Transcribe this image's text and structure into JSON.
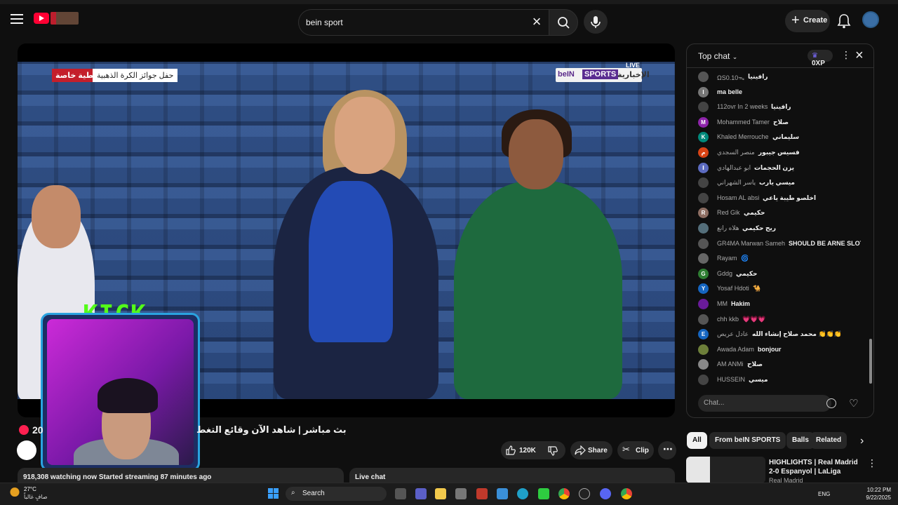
{
  "topbar": {
    "search_value": "bein sport",
    "create_label": "Create"
  },
  "video": {
    "badge_red": "تغطية خاصة",
    "badge_white": "حفل جوائز الكرة الذهبية",
    "bein_logo": "beIN",
    "bein_sports": "SPORTS",
    "bein_ar": "الإخبارية",
    "live_tag": "LIVE",
    "overlay_kick": "KICK"
  },
  "info": {
    "viewers_short": "20",
    "title": "بث مباشر | شاهد الآن وقائع التغط",
    "likes": "120K",
    "share_label": "Share",
    "clip_label": "Clip",
    "desc_text": "918,308 watching now  Started streaming 87 minutes ago",
    "live_chat_label": "Live chat"
  },
  "chat": {
    "header_title": "Top chat",
    "xp_label": "0XP",
    "input_placeholder": "Chat...",
    "messages": [
      {
        "author": "ΩS0.10ᯓ",
        "text": "رافينيا",
        "color": "#555",
        "initial": ""
      },
      {
        "author": "",
        "text": "ma belle",
        "color": "#777",
        "initial": "I"
      },
      {
        "author": "112ovr In 2 weeks",
        "text": "رافينيا",
        "color": "#444",
        "initial": ""
      },
      {
        "author": "Mohammed Tamer",
        "text": "صلاح",
        "color": "#8e24aa",
        "initial": "M"
      },
      {
        "author": "Khaled Merrouche",
        "text": "سليماني",
        "color": "#00897b",
        "initial": "K"
      },
      {
        "author": "منصر السجدي",
        "text": "فسيس جيبور",
        "color": "#d84315",
        "initial": "م"
      },
      {
        "author": "ابو عبدالهادي",
        "text": "يزن الحجمات",
        "color": "#5c6bc0",
        "initial": "ا"
      },
      {
        "author": "ياسر الشهراني",
        "text": "ميسي يارب",
        "color": "#444",
        "initial": ""
      },
      {
        "author": "Hosam AL absi",
        "text": "اخلصو طيبة ياعي",
        "color": "#444",
        "initial": ""
      },
      {
        "author": "Red Gik",
        "text": "حكيمي",
        "color": "#8d6e63",
        "initial": "R"
      },
      {
        "author": "هلاه رانع",
        "text": "ريح حكيمي",
        "color": "#546e7a",
        "initial": ""
      },
      {
        "author": "GR4MA Marwan Sameh",
        "text": "SHOULD BE ARNE SLOT",
        "color": "#555",
        "initial": ""
      },
      {
        "author": "Rayam",
        "text": "🌀",
        "color": "#666",
        "initial": ""
      },
      {
        "author": "Gddg",
        "text": "حكيمي",
        "color": "#2e7d32",
        "initial": "G"
      },
      {
        "author": "Yosaf Hdoti",
        "text": "🐪",
        "color": "#1565c0",
        "initial": "Y"
      },
      {
        "author": "MM",
        "text": "Hakim",
        "color": "#6a1b9a",
        "initial": ""
      },
      {
        "author": "chh kkb",
        "text": "💗💗💗",
        "color": "#555",
        "initial": ""
      },
      {
        "author": "عادل عريص",
        "text": "محمد صلاح إنشاء الله 👏👏👏",
        "color": "#1565c0",
        "initial": "E"
      },
      {
        "author": "Awada Adam",
        "text": "bonjour",
        "color": "#6d7f3a",
        "initial": ""
      },
      {
        "author": "AM ANMi",
        "text": "صلاح",
        "color": "#888",
        "initial": ""
      },
      {
        "author": "HUSSEIN",
        "text": "ميسي",
        "color": "#444",
        "initial": ""
      }
    ]
  },
  "chips": [
    "All",
    "From beIN SPORTS",
    "Balls",
    "Related"
  ],
  "recommendation": {
    "title": "HIGHLIGHTS | Real Madrid 2-0 Espanyol | LaLiga",
    "channel": "Real Madrid"
  },
  "taskbar": {
    "temp": "27°C",
    "weather_desc": "صافٍ غالباً",
    "search_label": "Search",
    "lang": "ENG",
    "time": "10:22 PM",
    "date": "9/22/2025"
  }
}
